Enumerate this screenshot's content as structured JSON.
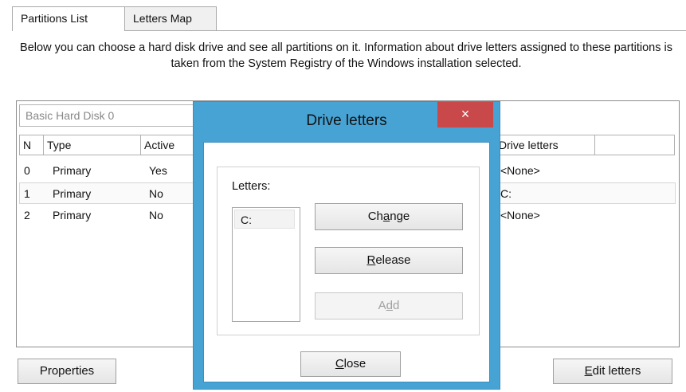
{
  "tabs": [
    {
      "label": "Partitions List",
      "active": true
    },
    {
      "label": "Letters Map",
      "active": false
    }
  ],
  "intro_text": "Below you can choose a hard disk drive and see all partitions on it. Information about drive letters assigned to these partitions is taken from the System Registry of the Windows installation selected.",
  "disk_select": {
    "value": "Basic Hard Disk 0"
  },
  "table": {
    "headers": [
      "N",
      "Type",
      "Active",
      "Drive letters"
    ],
    "rows": [
      {
        "n": "0",
        "type": "Primary",
        "active": "Yes",
        "letters": "<None>",
        "selected": false
      },
      {
        "n": "1",
        "type": "Primary",
        "active": "No",
        "letters": "C:",
        "selected": true
      },
      {
        "n": "2",
        "type": "Primary",
        "active": "No",
        "letters": "<None>",
        "selected": false
      }
    ]
  },
  "buttons": {
    "properties": "Properties",
    "edit_letters_mnemonic": "E",
    "edit_letters_rest": "dit letters"
  },
  "dialog": {
    "title": "Drive letters",
    "close_glyph": "×",
    "letters_label": "Letters:",
    "letters": [
      "C:"
    ],
    "change_pre": "Ch",
    "change_mnemonic": "a",
    "change_post": "nge",
    "release_mnemonic": "R",
    "release_rest": "elease",
    "add_pre": "A",
    "add_mnemonic": "d",
    "add_post": "d",
    "add_enabled": false,
    "close_mnemonic": "C",
    "close_rest": "lose"
  },
  "colors": {
    "dialog_frame": "#46a3d4",
    "close_button": "#c9494a"
  }
}
